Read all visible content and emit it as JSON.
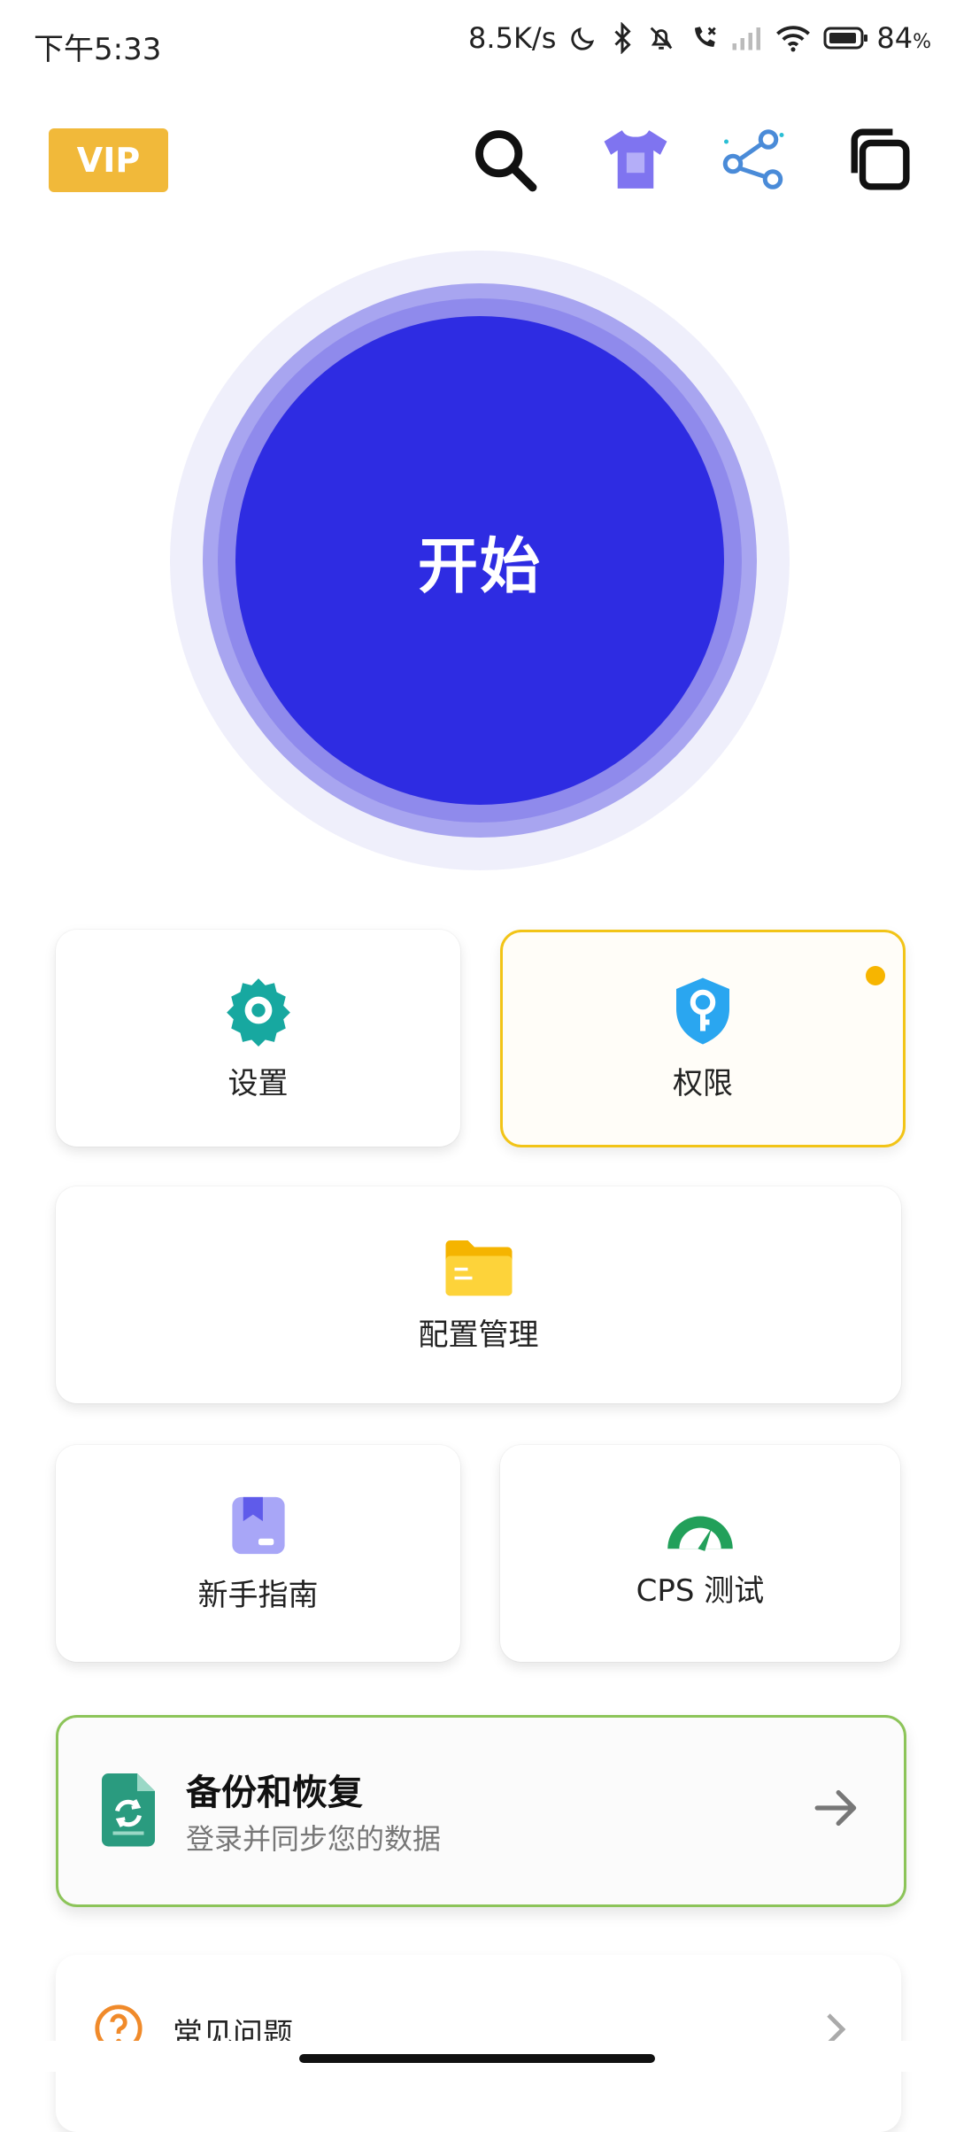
{
  "status_bar": {
    "time": "下午5:33",
    "net_speed": "8.5K/s",
    "battery": "84",
    "battery_unit": "%"
  },
  "toolbar": {
    "vip_label": "VIP",
    "icons": [
      "search-icon",
      "theme-shirt-icon",
      "share-icon",
      "multi-window-icon"
    ]
  },
  "start_button": {
    "label": "开始"
  },
  "grid": {
    "settings": {
      "label": "设置",
      "icon": "gear-icon"
    },
    "permissions": {
      "label": "权限",
      "icon": "shield-key-icon",
      "has_badge": true
    },
    "config": {
      "label": "配置管理",
      "icon": "folder-icon"
    },
    "guide": {
      "label": "新手指南",
      "icon": "book-icon"
    },
    "cps": {
      "label": "CPS 测试",
      "icon": "speedometer-icon"
    }
  },
  "backup": {
    "title": "备份和恢复",
    "subtitle": "登录并同步您的数据",
    "icon": "sync-document-icon",
    "arrow": "arrow-right-icon"
  },
  "faq": {
    "label": "常见问题",
    "icon": "question-icon"
  },
  "colors": {
    "accent": "#2e2ce2",
    "vip": "#f1b93a",
    "permission_border": "#f2c417",
    "backup_border": "#8cc459",
    "settings_icon": "#17a8a0",
    "perm_icon": "#2aa6f0",
    "folder_icon": "#f7c318",
    "guide_icon": "#9a98f5",
    "cps_icon": "#22a05a"
  }
}
